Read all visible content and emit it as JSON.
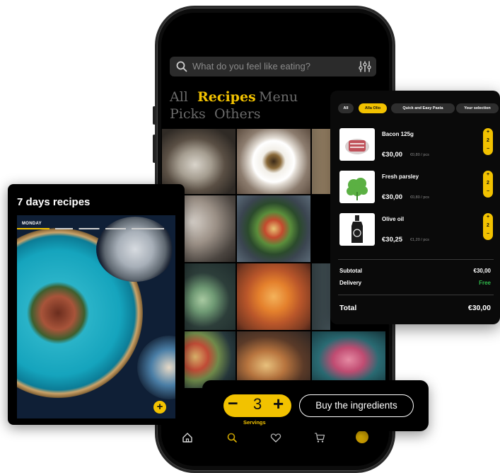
{
  "search": {
    "placeholder": "What do you feel like eating?"
  },
  "categories": [
    {
      "label": "All",
      "active": false
    },
    {
      "label": "Recipes",
      "active": true
    },
    {
      "label": "Menu",
      "active": false
    },
    {
      "label": "Picks",
      "active": false
    },
    {
      "label": "Others",
      "active": false
    }
  ],
  "weekly": {
    "title": "7 days recipes",
    "day_label": "MONDAY",
    "add_glyph": "+"
  },
  "cart": {
    "filters": [
      {
        "label": "All",
        "active": false
      },
      {
        "label": "Alla Olio",
        "active": true
      },
      {
        "label": "Quick and Easy Pasta",
        "active": false
      },
      {
        "label": "Your selection",
        "active": false
      }
    ],
    "items": [
      {
        "name": "Bacon 125g",
        "price": "€30,00",
        "unit_price": "€0,80 / pcs",
        "qty": "2",
        "icon": "bacon-icon"
      },
      {
        "name": "Fresh parsley",
        "price": "€30,00",
        "unit_price": "€0,80 / pcs",
        "qty": "2",
        "icon": "parsley-icon"
      },
      {
        "name": "Olive oil",
        "price": "€30,25",
        "unit_price": "€1,20 / pcs",
        "qty": "2",
        "icon": "olive-oil-icon"
      }
    ],
    "subtotal_label": "Subtotal",
    "subtotal_value": "€30,00",
    "delivery_label": "Delivery",
    "delivery_value": "Free",
    "total_label": "Total",
    "total_value": "€30,00"
  },
  "servings": {
    "minus": "−",
    "count": "3",
    "plus": "+",
    "label": "Servings"
  },
  "buy_button": "Buy the ingredients",
  "nav": [
    "home-icon",
    "search-icon",
    "heart-icon",
    "cart-icon",
    "profile-icon"
  ],
  "colors": {
    "accent": "#f2c200",
    "background": "#000000",
    "free_text": "#2fb84a"
  }
}
